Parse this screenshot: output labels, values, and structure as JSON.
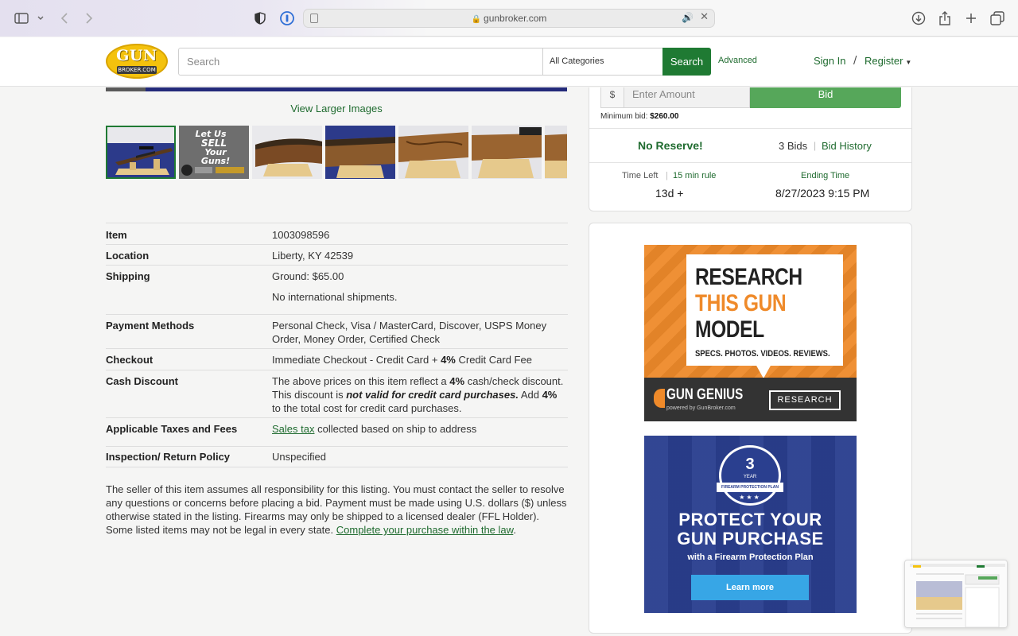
{
  "browser": {
    "url": "gunbroker.com",
    "toolbar_icons": [
      "sidebar-icon",
      "chevron-down-icon",
      "back-icon",
      "forward-icon",
      "shield-icon",
      "password-icon",
      "download-icon",
      "share-icon",
      "new-tab-icon",
      "tabs-icon"
    ]
  },
  "header": {
    "logo_top": "GUN",
    "logo_bottom": "BROKER.COM",
    "search_placeholder": "Search",
    "category": "All Categories",
    "search_button": "Search",
    "advanced": "Advanced",
    "sign_in": "Sign In",
    "separator": "/",
    "register": "Register"
  },
  "gallery": {
    "view_larger": "View Larger Images",
    "thumb2_text": "Let Us SELL Your Guns!"
  },
  "details": [
    {
      "label": "Item",
      "value": "1003098596"
    },
    {
      "label": "Location",
      "value": "Liberty, KY 42539"
    },
    {
      "label": "Shipping",
      "value": "Ground: $65.00",
      "value2": "No international shipments."
    },
    {
      "label": "Payment Methods",
      "value": "Personal Check, Visa / MasterCard, Discover, USPS Money Order, Money Order, Certified Check"
    },
    {
      "label": "Checkout",
      "value_a": "Immediate Checkout - Credit Card + ",
      "value_b": "4%",
      "value_c": " Credit Card Fee"
    },
    {
      "label": "Cash Discount",
      "p1": "The above prices on this item reflect a ",
      "p2": "4%",
      "p3": " cash/check discount. This discount is ",
      "p4": "not valid for credit card purchases.",
      "p5": " Add ",
      "p6": "4%",
      "p7": " to the total cost for credit card purchases."
    },
    {
      "label": "Applicable Taxes and Fees",
      "link": "Sales tax",
      "value": " collected based on ship to address"
    },
    {
      "label": "Inspection/ Return Policy",
      "value": "Unspecified"
    }
  ],
  "disclaimer": {
    "text": "The seller of this item assumes all responsibility for this listing. You must contact the seller to resolve any questions or concerns before placing a bid. Payment must be made using U.S. dollars ($) unless otherwise stated in the listing. Firearms may only be shipped to a licensed dealer (FFL Holder). Some listed items may not be legal in every state. ",
    "link": "Complete your purchase within the law",
    "end": "."
  },
  "bid": {
    "currency": "$",
    "amount_placeholder": "Enter Amount",
    "bid_button": "Bid",
    "min_bid_label": "Minimum bid:",
    "min_bid_value": "$260.00",
    "no_reserve": "No Reserve!",
    "bid_count": "3 Bids",
    "sep": "|",
    "bid_history": "Bid History",
    "time_left_label": "Time Left",
    "rule": "15 min rule",
    "time_left": "13d +",
    "ending_label": "Ending Time",
    "ending_time": "8/27/2023 9:15 PM"
  },
  "ads": {
    "ad1_line1": "RESEARCH",
    "ad1_line2": "THIS GUN",
    "ad1_line3": "MODEL",
    "ad1_sub": "SPECS. PHOTOS. VIDEOS. REVIEWS.",
    "ad1_brand": "GUN GENIUS",
    "ad1_brand_sub": "powered by GunBroker.com",
    "ad1_button": "RESEARCH",
    "ad2_badge_num": "3",
    "ad2_badge_year": "YEAR",
    "ad2_badge_ribbon": "FIREARM PROTECTION PLAN",
    "ad2_stars": "★★★",
    "ad2_line1": "PROTECT YOUR",
    "ad2_line2": "GUN PURCHASE",
    "ad2_sub": "with a Firearm Protection Plan",
    "ad2_button": "Learn more"
  },
  "colors": {
    "brand_green": "#1f7a33",
    "bid_green": "#56a75a",
    "logo_yellow": "#f4c20d",
    "ad_orange": "#ee8a2a",
    "ad_blue": "#2a3f8f"
  }
}
